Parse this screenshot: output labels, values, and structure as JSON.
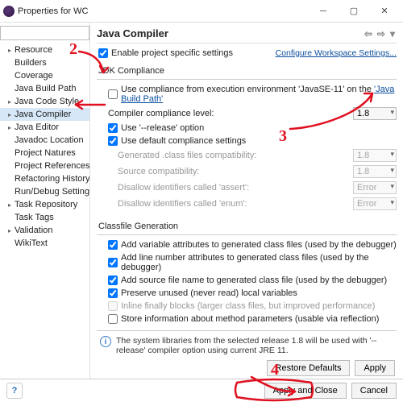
{
  "window": {
    "title": "Properties for WC"
  },
  "sidebar": {
    "filter_placeholder": "",
    "items": [
      {
        "label": "Resource",
        "exp": true
      },
      {
        "label": "Builders"
      },
      {
        "label": "Coverage"
      },
      {
        "label": "Java Build Path"
      },
      {
        "label": "Java Code Style",
        "exp": true
      },
      {
        "label": "Java Compiler",
        "exp": true,
        "selected": true
      },
      {
        "label": "Java Editor",
        "exp": true
      },
      {
        "label": "Javadoc Location"
      },
      {
        "label": "Project Natures"
      },
      {
        "label": "Project References"
      },
      {
        "label": "Refactoring History"
      },
      {
        "label": "Run/Debug Setting"
      },
      {
        "label": "Task Repository",
        "exp": true
      },
      {
        "label": "Task Tags"
      },
      {
        "label": "Validation",
        "exp": true
      },
      {
        "label": "WikiText"
      }
    ]
  },
  "content": {
    "title": "Java Compiler",
    "enable_specific": "Enable project specific settings",
    "configure_ws": "Configure Workspace Settings...",
    "jdk_group": "JDK Compliance",
    "use_compliance_prefix": "Use compliance from execution environment 'JavaSE-11' on the ",
    "build_path_link": "'Java Build Path'",
    "compliance_level_label": "Compiler compliance level:",
    "compliance_level_value": "1.8",
    "use_release": "Use '--release' option",
    "use_default": "Use default compliance settings",
    "gen_class_compat": "Generated .class files compatibility:",
    "gen_class_compat_v": "1.8",
    "src_compat": "Source compatibility:",
    "src_compat_v": "1.8",
    "disallow_assert": "Disallow identifiers called 'assert':",
    "disallow_assert_v": "Error",
    "disallow_enum": "Disallow identifiers called 'enum':",
    "disallow_enum_v": "Error",
    "classfile_group": "Classfile Generation",
    "cf1": "Add variable attributes to generated class files (used by the debugger)",
    "cf2": "Add line number attributes to generated class files (used by the debugger)",
    "cf3": "Add source file name to generated class file (used by the debugger)",
    "cf4": "Preserve unused (never read) local variables",
    "cf5": "Inline finally blocks (larger class files, but improved performance)",
    "cf6": "Store information about method parameters (usable via reflection)",
    "info_text": "The system libraries from the selected release 1.8 will be used with '--release' compiler option using current JRE 11.",
    "restore_defaults": "Restore Defaults",
    "apply": "Apply",
    "apply_close": "Apply and Close",
    "cancel": "Cancel"
  }
}
